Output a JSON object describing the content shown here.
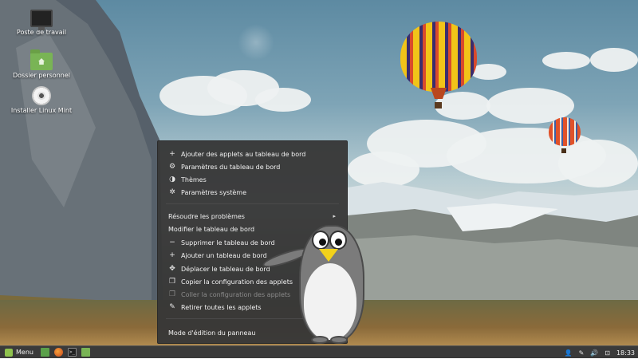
{
  "desktop": {
    "icons": [
      {
        "label": "Poste de travail",
        "icon": "computer-icon"
      },
      {
        "label": "Dossier personnel",
        "icon": "home-folder-icon"
      },
      {
        "label": "Installer Linux Mint",
        "icon": "disc-icon"
      }
    ]
  },
  "context_menu": {
    "items": [
      {
        "label": "Ajouter des applets au tableau de bord",
        "icon": "plus-icon",
        "glyph": "+"
      },
      {
        "label": "Paramètres du tableau de bord",
        "icon": "settings-icon",
        "glyph": "⚙"
      },
      {
        "label": "Thèmes",
        "icon": "themes-icon",
        "glyph": "◑"
      },
      {
        "label": "Paramètres système",
        "icon": "system-settings-icon",
        "glyph": "✲"
      },
      {
        "label": "Résoudre les problèmes",
        "icon": "",
        "glyph": "",
        "submenu_arrow": "▸"
      },
      {
        "label": "Modifier le tableau de bord",
        "icon": "",
        "glyph": ""
      },
      {
        "label": "Supprimer le tableau de bord",
        "icon": "minus-icon",
        "glyph": "−"
      },
      {
        "label": "Ajouter un tableau de bord",
        "icon": "plus-icon",
        "glyph": "+"
      },
      {
        "label": "Déplacer le tableau de bord",
        "icon": "move-icon",
        "glyph": "✥"
      },
      {
        "label": "Copier la configuration des applets",
        "icon": "copy-icon",
        "glyph": "❐"
      },
      {
        "label": "Coller la configuration des applets",
        "icon": "paste-icon",
        "glyph": "❐",
        "disabled": true
      },
      {
        "label": "Retirer toutes les applets",
        "icon": "broom-icon",
        "glyph": "✎"
      },
      {
        "label": "Mode d'édition du panneau",
        "icon": "",
        "glyph": ""
      }
    ]
  },
  "taskbar": {
    "menu_label": "Menu",
    "launchers": [
      "show-desktop-icon",
      "firefox-icon",
      "terminal-icon",
      "files-icon"
    ],
    "terminal_glyph": ">_",
    "tray": [
      "user-icon",
      "pen-icon",
      "volume-icon",
      "battery-icon"
    ],
    "tray_glyphs": [
      "👤",
      "✎",
      "🔊",
      "⊡"
    ],
    "clock": "18:33"
  },
  "colors": {
    "menu_bg": "#373737",
    "taskbar_bg": "#3a3a3a",
    "mint_green": "#8fc24e"
  }
}
